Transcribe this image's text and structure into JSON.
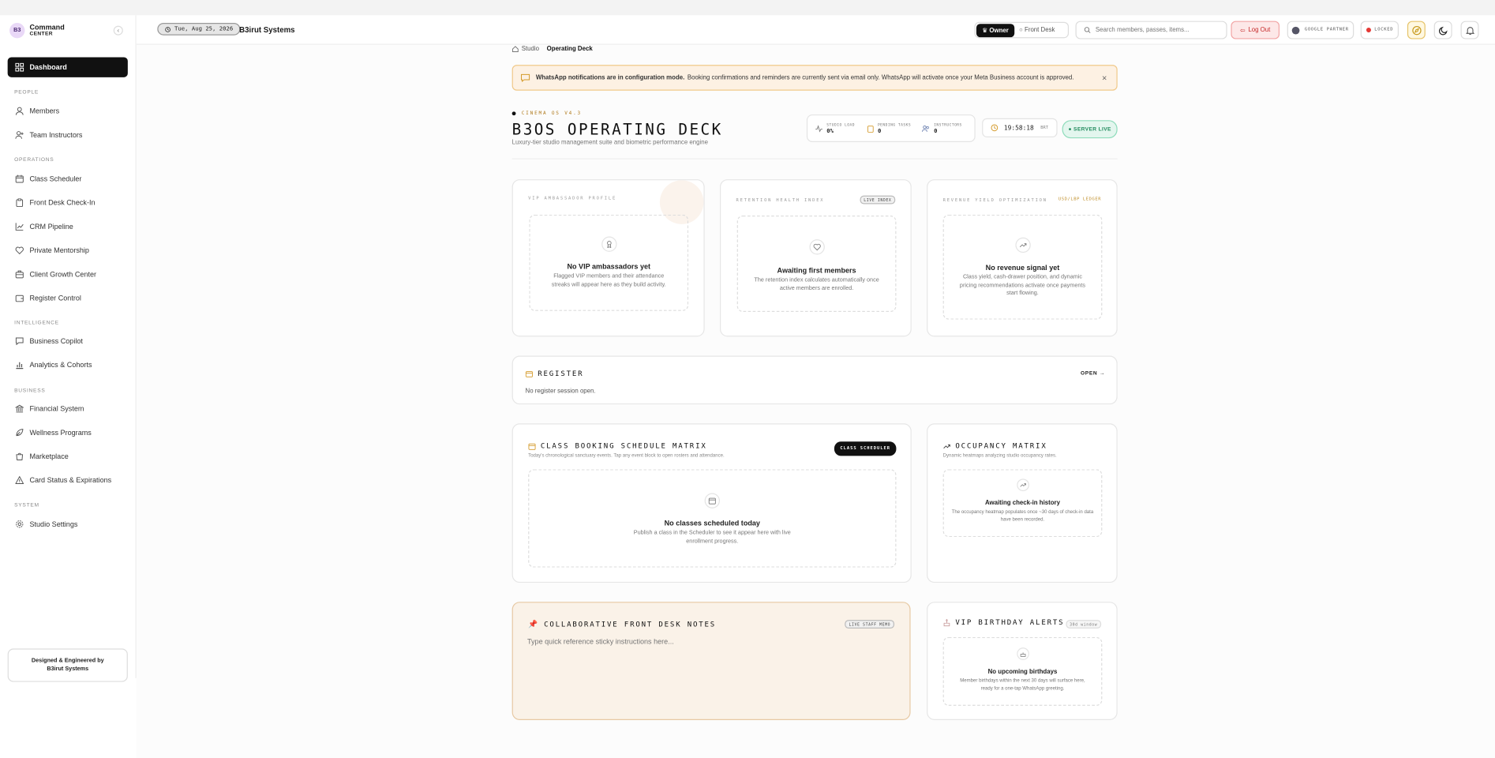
{
  "brand": {
    "logo": "B3",
    "title": "Command",
    "subtitle": "CENTER"
  },
  "sidebar": {
    "dashboard": "Dashboard",
    "sections": {
      "people": "PEOPLE",
      "operations": "OPERATIONS",
      "intelligence": "INTELLIGENCE",
      "business": "BUSINESS",
      "system": "SYSTEM"
    },
    "items": {
      "members": "Members",
      "team_instructors": "Team Instructors",
      "class_scheduler": "Class Scheduler",
      "front_desk_checkin": "Front Desk Check-In",
      "crm_pipeline": "CRM Pipeline",
      "private_mentorship": "Private Mentorship",
      "client_growth_center": "Client Growth Center",
      "register_control": "Register Control",
      "business_copilot": "Business Copilot",
      "analytics_cohorts": "Analytics & Cohorts",
      "financial_system": "Financial System",
      "wellness_programs": "Wellness Programs",
      "marketplace": "Marketplace",
      "card_status": "Card Status & Expirations",
      "studio_settings": "Studio Settings"
    },
    "credit_line1": "Designed & Engineered by",
    "credit_line2": "B3irut Systems"
  },
  "header": {
    "date": "Tue, Aug 25, 2026",
    "title": "B3irut Systems",
    "role_owner": "Owner",
    "role_front_desk": "Front Desk",
    "search_placeholder": "Search members, passes, items...",
    "logout": "Log Out",
    "google_partner": "GOOGLE PARTNER",
    "locked": "LOCKED"
  },
  "breadcrumb": {
    "root": "Studio",
    "current": "Operating Deck"
  },
  "banner": {
    "bold": "WhatsApp notifications are in configuration mode.",
    "text": "Booking confirmations and reminders are currently sent via email only. WhatsApp will activate once your Meta Business account is approved.",
    "close": "×"
  },
  "hero": {
    "eyebrow": "CINEMA OS V4.3",
    "title": "B3OS OPERATING DECK",
    "subtitle": "Luxury-tier studio management suite and biometric performance engine",
    "stats": [
      {
        "label": "STUDIO LOAD",
        "value": "0%"
      },
      {
        "label": "PENDING TASKS",
        "value": "0"
      },
      {
        "label": "INSTRUCTORS",
        "value": "0"
      }
    ],
    "clock": "19:58:18",
    "timezone": "BRT",
    "server_status": "● SERVER LIVE"
  },
  "cards": {
    "vip": {
      "tag": "VIP AMBASSADOR PROFILE",
      "title": "No VIP ambassadors yet",
      "desc": "Flagged VIP members and their attendance streaks will appear here as they build activity."
    },
    "retention": {
      "tag": "RETENTION HEALTH INDEX",
      "badge": "LIVE INDEX",
      "title": "Awaiting first members",
      "desc": "The retention index calculates automatically once active members are enrolled."
    },
    "revenue": {
      "tag": "REVENUE YIELD OPTIMIZATION",
      "badge": "USD/LBP LEDGER",
      "title": "No revenue signal yet",
      "desc": "Class yield, cash-drawer position, and dynamic pricing recommendations activate once payments start flowing."
    }
  },
  "register": {
    "title": "REGISTER",
    "open": "OPEN →",
    "status": "No register session open."
  },
  "schedule": {
    "title": "CLASS BOOKING SCHEDULE MATRIX",
    "subtitle": "Today's chronological sanctuary events. Tap any event block to open rosters and attendance.",
    "button": "CLASS SCHEDULER",
    "empty_title": "No classes scheduled today",
    "empty_desc": "Publish a class in the Scheduler to see it appear here with live enrollment progress."
  },
  "occupancy": {
    "title": "OCCUPANCY MATRIX",
    "subtitle": "Dynamic heatmaps analyzing studio occupancy rates.",
    "empty_title": "Awaiting check-in history",
    "empty_desc": "The occupancy heatmap populates once ~30 days of check-in data have been recorded."
  },
  "notes": {
    "title": "COLLABORATIVE FRONT DESK NOTES",
    "badge": "LIVE STAFF MEMO",
    "placeholder": "Type quick reference sticky instructions here..."
  },
  "birthdays": {
    "title": "VIP BIRTHDAY ALERTS",
    "badge": "30d window",
    "empty_title": "No upcoming birthdays",
    "empty_desc": "Member birthdays within the next 30 days will surface here, ready for a one-tap WhatsApp greeting."
  },
  "icons": {
    "dashboard": "grid-icon",
    "members": "user-icon",
    "instructors": "user-plus-icon",
    "scheduler": "calendar-icon",
    "checkin": "clipboard-icon",
    "crm": "trend-icon",
    "mentorship": "heart-icon",
    "growth": "briefcase-icon",
    "register": "wallet-icon",
    "copilot": "chat-icon",
    "analytics": "bar-chart-icon",
    "financial": "bank-icon",
    "wellness": "leaf-icon",
    "marketplace": "bag-icon",
    "card_status": "warning-icon",
    "settings": "gear-icon"
  },
  "colors": {
    "accent_black": "#111111",
    "banner_bg": "#fdf1e3",
    "logout_red": "#c62828",
    "live_green": "#1f8a5c",
    "eyebrow_gold": "#b07a1c"
  }
}
